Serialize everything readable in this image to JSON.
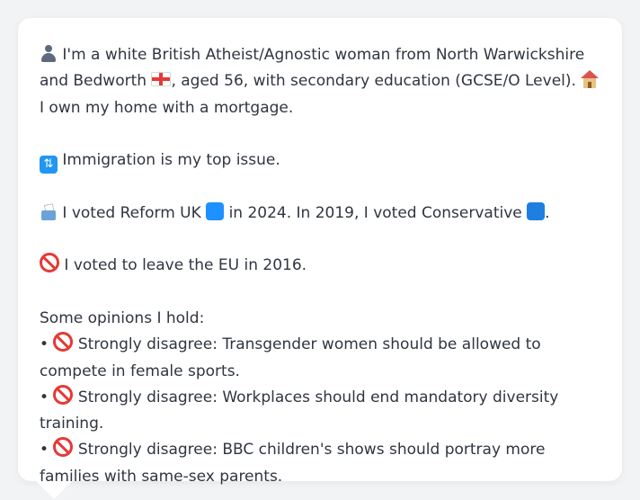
{
  "profile": {
    "line1_part1": "I'm a white British Atheist/Agnostic woman from North Warwickshire and Bedworth",
    "line1_part2": ", aged 56, with secondary education (GCSE/O Level).",
    "line1_part3": "I own my home with a mortgage.",
    "top_issue": "Immigration is my top issue.",
    "vote_part1": "I voted Reform UK",
    "vote_part2": "in 2024. In 2019, I voted Conservative",
    "vote_part3": ".",
    "eu_vote": "I voted to leave the EU in 2016.",
    "opinions_heading": "Some opinions I hold:",
    "opinions": [
      {
        "bullet": "•",
        "stance": "Strongly disagree",
        "text": "Transgender women should be allowed to compete in female sports."
      },
      {
        "bullet": "•",
        "stance": "Strongly disagree",
        "text": "Workplaces should end mandatory diversity training."
      },
      {
        "bullet": "•",
        "stance": "Strongly disagree",
        "text": "BBC children's shows should portray more families with same-sex parents."
      }
    ]
  },
  "colors": {
    "reform_square": "#1e90ff",
    "conservative_square": "#1e7fe0",
    "text": "#2f3640",
    "bubble": "#ffffff",
    "background": "#f1f3f5"
  },
  "icons": {
    "person": "person-silhouette-icon",
    "flag": "england-flag-icon",
    "house": "house-icon",
    "immigration": "immigration-icon",
    "ballot": "ballot-box-icon",
    "noentry": "no-entry-icon"
  }
}
